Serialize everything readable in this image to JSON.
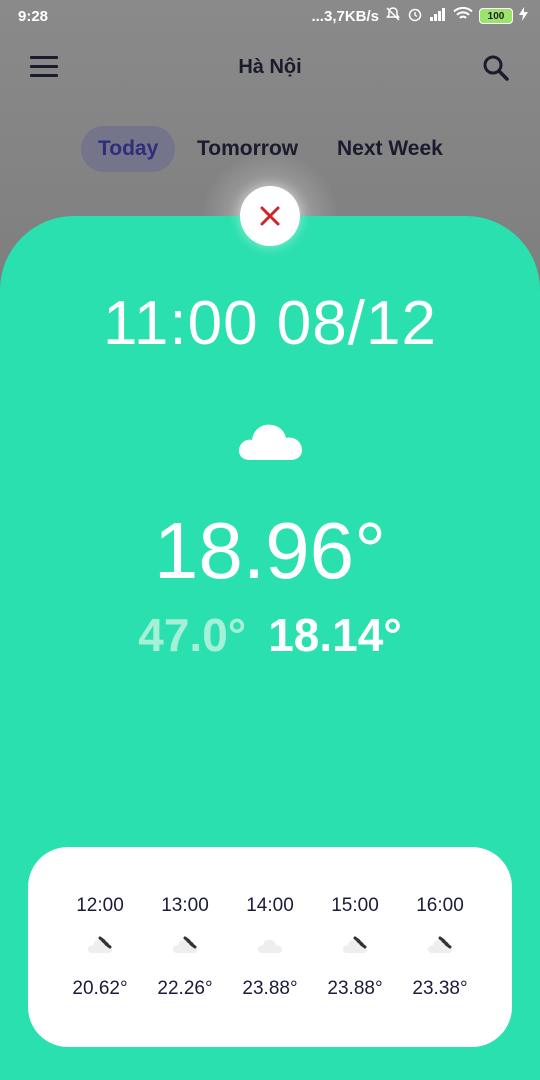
{
  "status_bar": {
    "time": "9:28",
    "network_speed": "...3,7KB/s",
    "battery": "100",
    "icons": [
      "notifications-off-icon",
      "alarm-icon",
      "signal-icon",
      "wifi-icon",
      "battery-icon",
      "charging-icon"
    ]
  },
  "header": {
    "city": "Hà Nội",
    "menu_icon": "menu-icon",
    "search_icon": "search-icon"
  },
  "tabs": [
    {
      "label": "Today",
      "active": true
    },
    {
      "label": "Tomorrow",
      "active": false
    },
    {
      "label": "Next Week",
      "active": false
    }
  ],
  "detail": {
    "datetime": "11:00 08/12",
    "condition_icon": "cloud-icon",
    "temperature": "18.96°",
    "temp_max": "47.0°",
    "temp_min": "18.14°"
  },
  "hourly": [
    {
      "time": "12:00",
      "icon": "cloud-rain-icon",
      "temp": "20.62°"
    },
    {
      "time": "13:00",
      "icon": "cloud-rain-icon",
      "temp": "22.26°"
    },
    {
      "time": "14:00",
      "icon": "cloud-icon",
      "temp": "23.88°"
    },
    {
      "time": "15:00",
      "icon": "cloud-rain-icon",
      "temp": "23.88°"
    },
    {
      "time": "16:00",
      "icon": "cloud-rain-icon",
      "temp": "23.38°"
    }
  ],
  "colors": {
    "accent": "#2ae0ae",
    "close_icon": "#d0242b",
    "text_dark": "#1b1b3a"
  }
}
